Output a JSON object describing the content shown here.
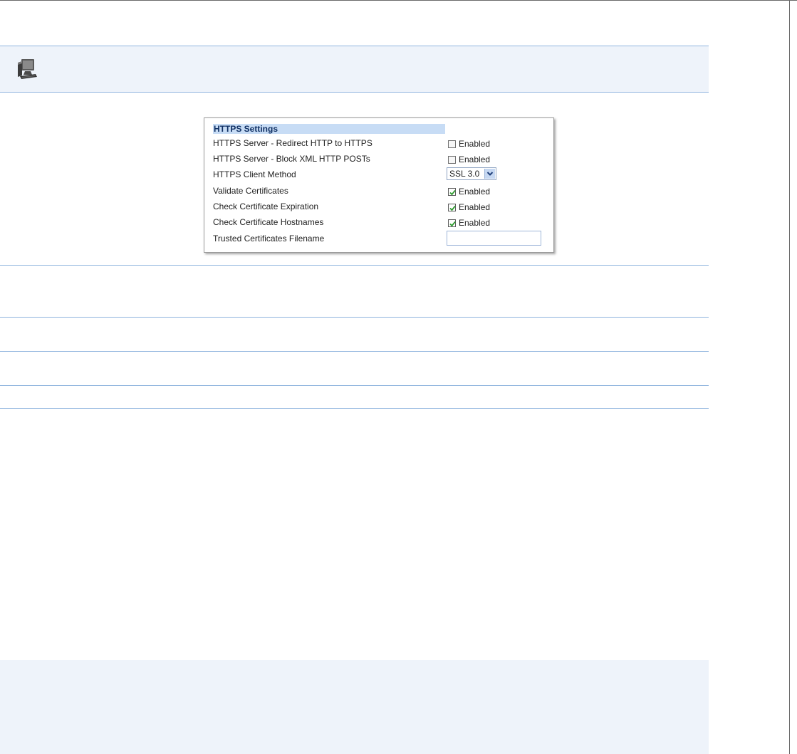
{
  "panel": {
    "header": "HTTPS Settings",
    "rows": [
      {
        "label": "HTTPS Server - Redirect HTTP to HTTPS",
        "control": "checkbox",
        "checked": false,
        "text": "Enabled"
      },
      {
        "label": "HTTPS Server - Block XML HTTP POSTs",
        "control": "checkbox",
        "checked": false,
        "text": "Enabled"
      },
      {
        "label": "HTTPS Client Method",
        "control": "select",
        "value": "SSL 3.0"
      },
      {
        "label": "Validate Certificates",
        "control": "checkbox",
        "checked": true,
        "text": "Enabled"
      },
      {
        "label": "Check Certificate Expiration",
        "control": "checkbox",
        "checked": true,
        "text": "Enabled"
      },
      {
        "label": "Check Certificate Hostnames",
        "control": "checkbox",
        "checked": true,
        "text": "Enabled"
      },
      {
        "label": "Trusted Certificates Filename",
        "control": "text",
        "value": ""
      }
    ]
  },
  "icons": {
    "top_band": "computer-icon",
    "select": "chevron-down-icon",
    "checked": "checkmark-icon"
  },
  "colors": {
    "band_bg": "#eef3fa",
    "rule": "#8fb4de",
    "header_bg": "#c7dcf5",
    "header_text": "#0f2f63",
    "check": "#2c9a2c"
  }
}
